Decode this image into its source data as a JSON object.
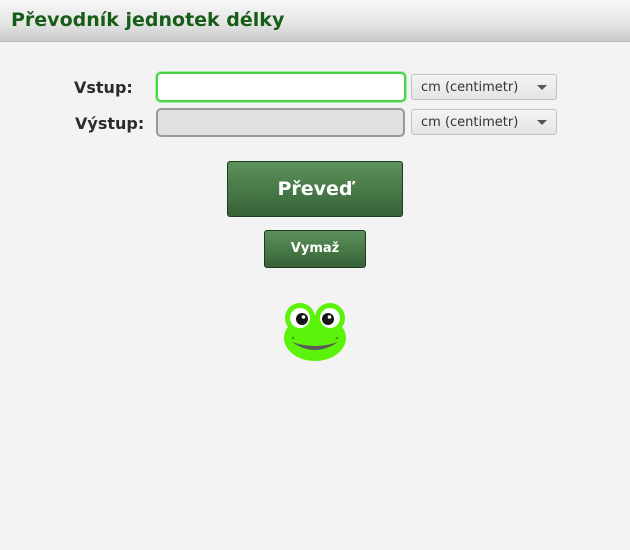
{
  "window": {
    "title": "Převodník jednotek délky"
  },
  "form": {
    "input_label": "Vstup:",
    "input_value": "",
    "input_unit": "cm (centimetr)",
    "output_label": "Výstup:",
    "output_value": "",
    "output_unit": "cm (centimetr)"
  },
  "buttons": {
    "convert_label": "Převeď",
    "clear_label": "Vymaž"
  },
  "mascot": {
    "icon": "frog-icon"
  },
  "colors": {
    "title_text": "#175c17",
    "button_green": "#477847",
    "input_focus_border": "#4ad24a",
    "frog_green": "#5df20a"
  }
}
